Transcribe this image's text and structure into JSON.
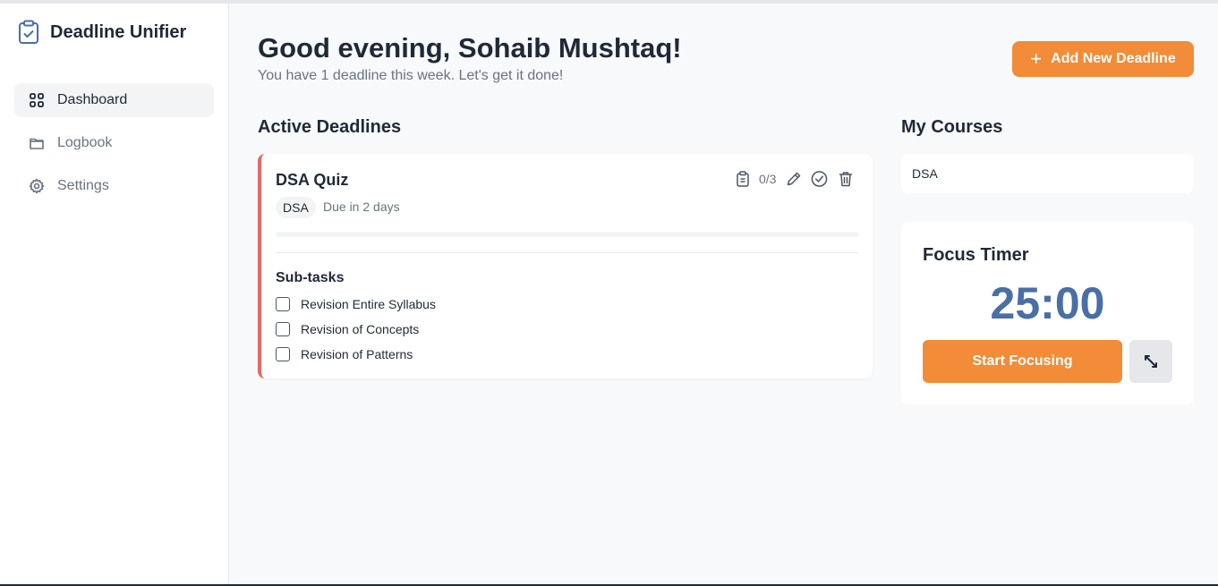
{
  "app": {
    "title": "Deadline Unifier"
  },
  "sidebar": {
    "items": [
      {
        "label": "Dashboard",
        "icon": "dashboard-grid-icon",
        "active": true
      },
      {
        "label": "Logbook",
        "icon": "folder-icon",
        "active": false
      },
      {
        "label": "Settings",
        "icon": "gear-icon",
        "active": false
      }
    ]
  },
  "header": {
    "greeting": "Good evening, Sohaib Mushtaq!",
    "subtitle": "You have 1 deadline this week. Let's get it done!",
    "add_button_label": "Add New Deadline"
  },
  "deadlines": {
    "section_title": "Active Deadlines",
    "items": [
      {
        "title": "DSA Quiz",
        "course": "DSA",
        "due": "Due in 2 days",
        "progress_text": "0/3",
        "progress_fraction": 0,
        "subtasks_title": "Sub-tasks",
        "subtasks": [
          {
            "label": "Revision Entire Syllabus",
            "done": false
          },
          {
            "label": "Revision of Concepts",
            "done": false
          },
          {
            "label": "Revision of Patterns",
            "done": false
          }
        ]
      }
    ]
  },
  "courses": {
    "section_title": "My Courses",
    "items": [
      "DSA"
    ]
  },
  "focus_timer": {
    "title": "Focus Timer",
    "time": "25:00",
    "start_label": "Start Focusing"
  },
  "colors": {
    "accent": "#f28c38",
    "deadline_border": "#e36a6a",
    "timer_text": "#4a6fa5"
  }
}
